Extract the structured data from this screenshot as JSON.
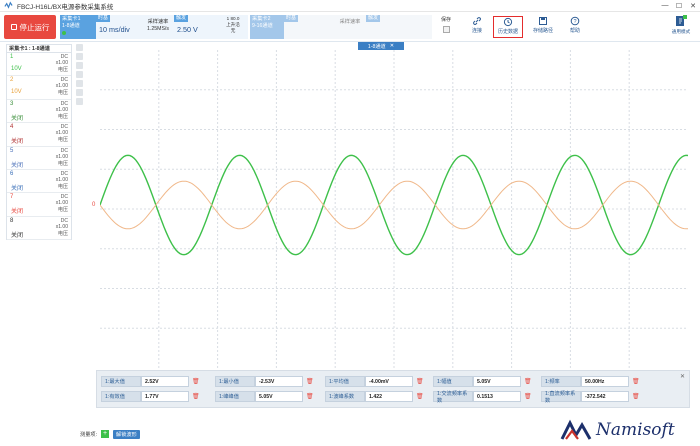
{
  "window": {
    "title": "FBCJ-H16L/BX电源参数采集系统"
  },
  "toolbar": {
    "stop_label": "停止运行",
    "card1": {
      "title": "采集卡1",
      "subtitle": "1-8通道"
    },
    "timebase": {
      "tag": "时基",
      "value": "10 ms/div"
    },
    "sample_rate": {
      "label": "采样速率",
      "value": "1.25MS/s"
    },
    "trigger": {
      "tag": "触发",
      "value": "2.50 V"
    },
    "trigger_extra": {
      "a": "1",
      "b": "80.0",
      "c": "上升沿",
      "d": "无"
    },
    "card2": {
      "title": "采集卡2",
      "subtitle": "9-16通道"
    },
    "timebase2": {
      "tag": "时基"
    },
    "sample_rate2": {
      "label": "采样速率"
    },
    "trigger2": {
      "tag": "触发"
    },
    "save_label": "保存",
    "tools": [
      {
        "label": "连接",
        "icon": "link-icon"
      },
      {
        "label": "历史数据",
        "icon": "history-icon"
      },
      {
        "label": "存储路径",
        "icon": "save-path-icon"
      },
      {
        "label": "帮助",
        "icon": "help-icon"
      }
    ],
    "logo_label": "通用模式"
  },
  "left_panel": {
    "header": "采集卡1 : 1-8通道",
    "channels": [
      {
        "num": "1",
        "coupling": "DC",
        "scale": "x1.00",
        "type": "电压",
        "state": "10V",
        "color": "#3ec04a"
      },
      {
        "num": "2",
        "coupling": "DC",
        "scale": "x1.00",
        "type": "电压",
        "state": "10V",
        "color": "#e8a13a"
      },
      {
        "num": "3",
        "coupling": "DC",
        "scale": "x1.00",
        "type": "电压",
        "state": "关闭",
        "color": "#3a8f3a"
      },
      {
        "num": "4",
        "coupling": "DC",
        "scale": "x1.00",
        "type": "电压",
        "state": "关闭",
        "color": "#b03030"
      },
      {
        "num": "5",
        "coupling": "DC",
        "scale": "x1.00",
        "type": "电压",
        "state": "关闭",
        "color": "#4a6fb8"
      },
      {
        "num": "6",
        "coupling": "DC",
        "scale": "x1.00",
        "type": "电压",
        "state": "关闭",
        "color": "#3a6fb8"
      },
      {
        "num": "7",
        "coupling": "DC",
        "scale": "x1.00",
        "type": "电压",
        "state": "关闭",
        "color": "#e8483f"
      },
      {
        "num": "8",
        "coupling": "DC",
        "scale": "x1.00",
        "type": "电压",
        "state": "关闭",
        "color": "#333333"
      }
    ]
  },
  "plot": {
    "tab_label": "1-8通道",
    "zero_label": "0",
    "grid_color": "#d8dde3",
    "series": [
      {
        "color": "#3ec04a",
        "amplitude_div": 1.25,
        "phase": 0.0,
        "period_div": 1.9
      },
      {
        "color": "#f0b88a",
        "amplitude_div": 0.6,
        "phase": 3.1416,
        "period_div": 1.9
      }
    ]
  },
  "measurements": [
    {
      "label": "1:最大值",
      "value": "2.52V"
    },
    {
      "label": "1:最小值",
      "value": "-2.53V"
    },
    {
      "label": "1:平均值",
      "value": "-4.00mV"
    },
    {
      "label": "1:幅值",
      "value": "5.05V"
    },
    {
      "label": "1:频率",
      "value": "50.00Hz"
    },
    {
      "label": "1:有效值",
      "value": "1.77V"
    },
    {
      "label": "1:峰峰值",
      "value": "5.05V"
    },
    {
      "label": "1:波峰系数",
      "value": "1.422"
    },
    {
      "label": "1:交流频率系数",
      "value": "0.1513"
    },
    {
      "label": "1:直流频率系数",
      "value": "-372.542"
    }
  ],
  "bottom": {
    "measure_label": "测量项:",
    "wave_button": "解锁波形"
  },
  "watermark": "Namisoft"
}
